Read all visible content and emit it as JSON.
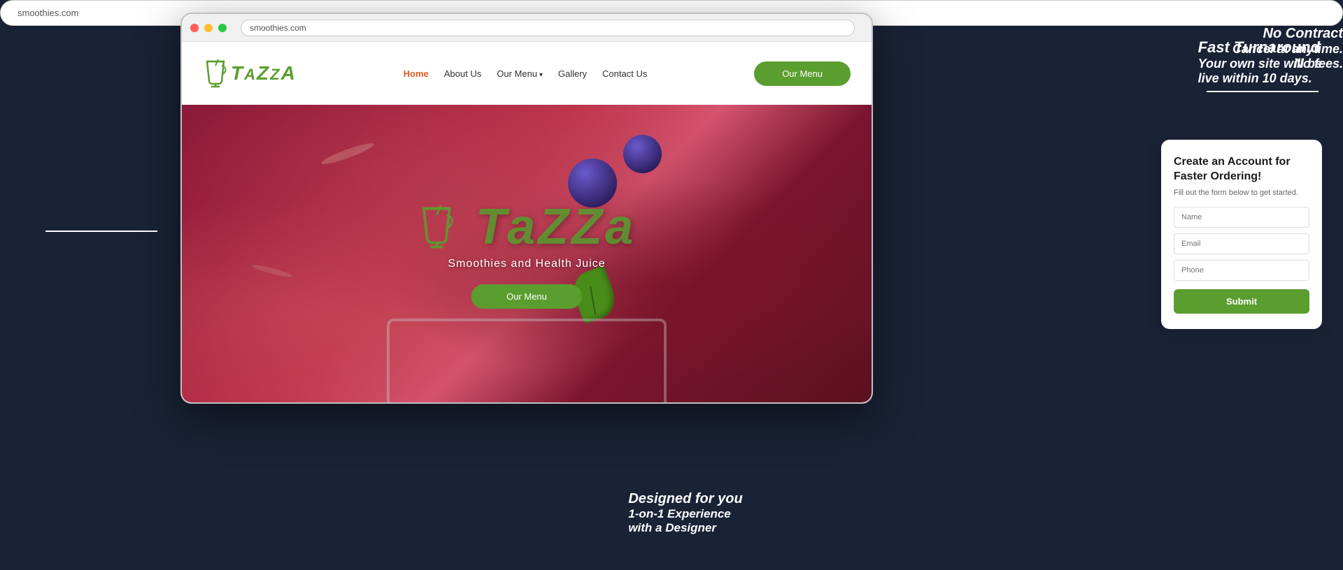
{
  "browser": {
    "address": "smoothies.com",
    "dots": [
      "red",
      "yellow",
      "green"
    ]
  },
  "navbar": {
    "logo_text": "TaZZa",
    "links": [
      {
        "label": "Home",
        "active": true
      },
      {
        "label": "About Us",
        "active": false
      },
      {
        "label": "Our Menu",
        "active": false,
        "has_arrow": true
      },
      {
        "label": "Gallery",
        "active": false
      },
      {
        "label": "Contact Us",
        "active": false
      }
    ],
    "cta_label": "Our Menu"
  },
  "hero": {
    "logo_big": "TaZZa",
    "subtitle": "Smoothies and Health Juice",
    "cta_label": "Our Menu"
  },
  "account_form": {
    "title": "Create an Account for Faster Ordering!",
    "subtitle": "Fill out the form below to get started.",
    "name_placeholder": "Name",
    "email_placeholder": "Email",
    "phone_placeholder": "Phone",
    "submit_label": "Submit"
  },
  "labels": {
    "url": "smoothies.com",
    "fast_turnaround_line1": "Fast Turnaround",
    "fast_turnaround_line2": "Your own site will be",
    "fast_turnaround_line3": "live within 10 days.",
    "no_contract_line1": "No Contract",
    "no_contract_line2": "Cancel at anytime.",
    "no_contract_line3": "No fees.",
    "designed_line1": "Designed for you",
    "designed_line2": "1-on-1 Experience",
    "designed_line3": "with a Designer"
  }
}
